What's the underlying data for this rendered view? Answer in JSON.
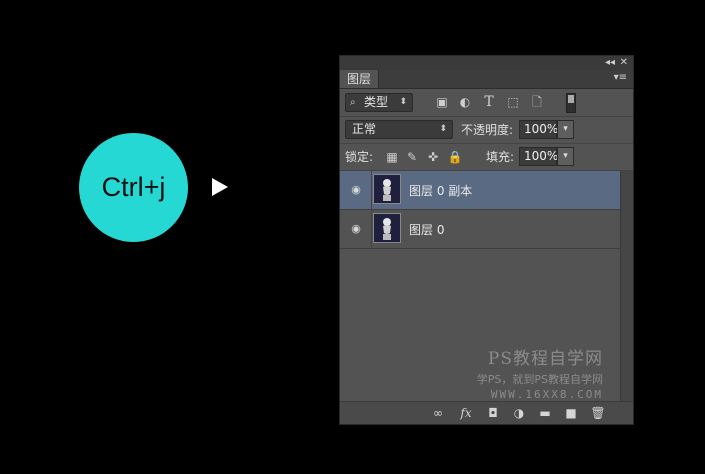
{
  "shortcut": {
    "label": "Ctrl+j",
    "circle_color": "#25d8d4"
  },
  "panel": {
    "tab_label": "图层",
    "titlebar": {
      "collapse_icon": "double-chevron-right-icon",
      "close_icon": "close-icon"
    },
    "menu_icon": "panel-menu-icon",
    "filter": {
      "selected": "类型",
      "icon": "search-icon",
      "filter_icons": [
        "image-filter-icon",
        "adjustment-filter-icon",
        "type-filter-icon",
        "shape-filter-icon",
        "smart-object-filter-icon",
        "filter-toggle-icon"
      ]
    },
    "blend_mode": {
      "selected": "正常"
    },
    "opacity": {
      "label": "不透明度:",
      "value": "100%"
    },
    "lock": {
      "label": "锁定:",
      "icons": [
        "lock-transparent-icon",
        "lock-image-icon",
        "lock-position-icon",
        "lock-all-icon"
      ]
    },
    "fill": {
      "label": "填充:",
      "value": "100%"
    },
    "layers": [
      {
        "name": "图层 0 副本",
        "visible": true,
        "selected": true
      },
      {
        "name": "图层 0",
        "visible": true,
        "selected": false
      }
    ],
    "selected_color": "#596a82",
    "bottom_icons": [
      "link-icon",
      "fx-icon",
      "mask-icon",
      "adjustment-layer-icon",
      "folder-icon",
      "new-layer-icon",
      "trash-icon"
    ]
  },
  "watermark": {
    "line1": "PS教程自学网",
    "line2": "学PS，就到PS教程自学网",
    "line3": "WWW.16XX8.COM"
  }
}
